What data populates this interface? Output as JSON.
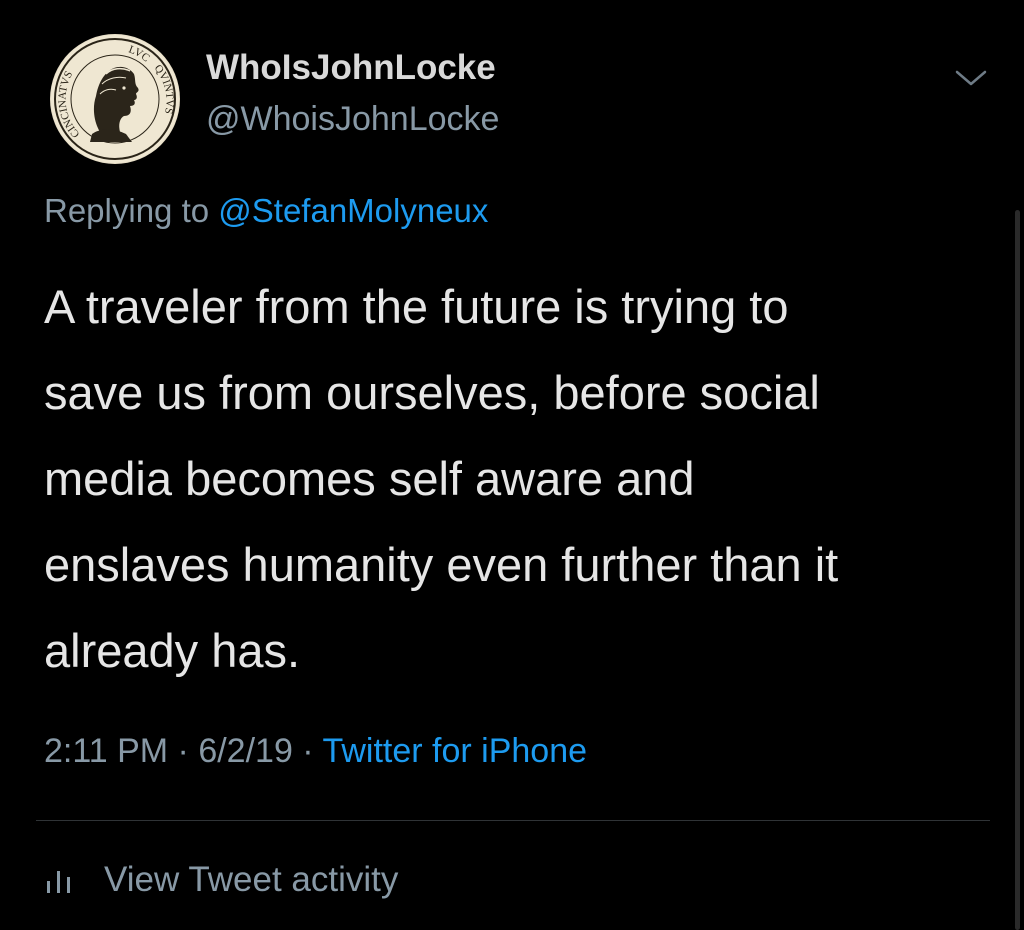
{
  "user": {
    "display_name": "WhoIsJohnLocke",
    "handle": "@WhoisJohnLocke",
    "avatar": {
      "icon": "coin-portrait-icon",
      "inscription_left": "CINCINATVS",
      "inscription_top": "LVC",
      "inscription_right": "QVINTVS"
    }
  },
  "reply": {
    "prefix": "Replying to ",
    "mention": "@StefanMolyneux"
  },
  "tweet": {
    "text": "A traveler from the future is trying to\nsave us from ourselves, before social\nmedia becomes self aware and\nenslaves humanity even further than it\nalready has."
  },
  "meta": {
    "time": "2:11 PM",
    "date": "6/2/19",
    "separator": " · ",
    "source": "Twitter for iPhone"
  },
  "activity": {
    "label": "View Tweet activity",
    "icon": "analytics-bars-icon"
  },
  "menu": {
    "icon": "chevron-down-icon"
  },
  "colors": {
    "background": "#000000",
    "text": "#e6e6e6",
    "secondary": "#8899a6",
    "link": "#1d9bf0",
    "divider": "#2f3336"
  }
}
